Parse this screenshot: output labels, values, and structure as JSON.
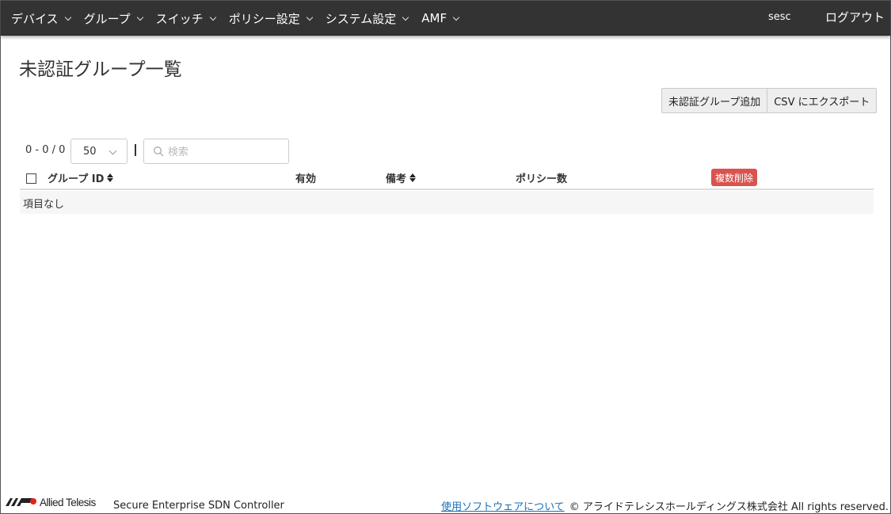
{
  "nav": {
    "items": [
      {
        "label": "デバイス"
      },
      {
        "label": "グループ"
      },
      {
        "label": "スイッチ"
      },
      {
        "label": "ポリシー設定"
      },
      {
        "label": "システム設定"
      },
      {
        "label": "AMF"
      }
    ],
    "user": "sesc",
    "logout": "ログアウト"
  },
  "page": {
    "title": "未認証グループ一覧"
  },
  "actions": {
    "add_label": "未認証グループ追加",
    "export_label": "CSV にエクスポート"
  },
  "list": {
    "range": "0 - 0 / 0",
    "page_size": "50",
    "search_placeholder": "検索",
    "search_value": ""
  },
  "table": {
    "columns": {
      "group_id": "グループ ID",
      "enabled": "有効",
      "remarks": "備考",
      "policy_count": "ポリシー数"
    },
    "bulk_delete_label": "複数削除",
    "empty_text": "項目なし"
  },
  "footer": {
    "brand": "Allied Telesis",
    "product": "Secure Enterprise SDN Controller",
    "software_link": "使用ソフトウェアについて",
    "copyright": "© アライドテレシスホールディングス株式会社 All rights reserved."
  },
  "colors": {
    "navbar": "#333333",
    "danger": "#d9534f",
    "link": "#1a6fb5",
    "brand_red": "#e2231a"
  }
}
